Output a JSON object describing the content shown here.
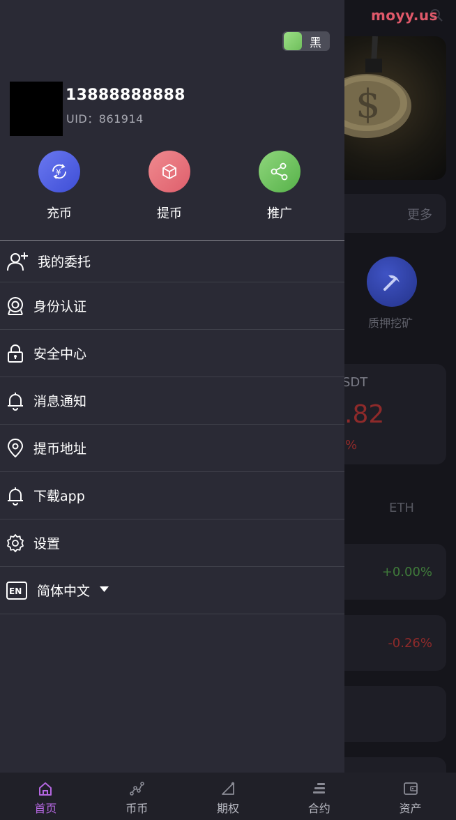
{
  "watermark": "moyy.us",
  "theme_toggle": {
    "label": "黑",
    "accent": "#7fcf6a"
  },
  "user": {
    "phone": "13888888888",
    "uid_label": "UID：",
    "uid": "861914"
  },
  "quick_actions": [
    {
      "label": "充币",
      "icon": "yen-cycle-icon",
      "color": "#4e5fe0"
    },
    {
      "label": "提币",
      "icon": "cube-icon",
      "color": "#e9727c"
    },
    {
      "label": "推广",
      "icon": "share-icon",
      "color": "#6ec25c"
    }
  ],
  "menu": [
    {
      "label": "我的委托",
      "icon": "user-add-icon"
    },
    {
      "label": "身份认证",
      "icon": "camera-icon"
    },
    {
      "label": "安全中心",
      "icon": "lock-icon"
    },
    {
      "label": "消息通知",
      "icon": "bell-icon"
    },
    {
      "label": "提币地址",
      "icon": "location-pin-icon"
    },
    {
      "label": "下载app",
      "icon": "bell-icon"
    },
    {
      "label": "设置",
      "icon": "gear-icon"
    },
    {
      "label": "简体中文",
      "icon": "en-icon"
    }
  ],
  "background": {
    "more": "更多",
    "mining_label": "质押挖矿",
    "usdt_fragment": "SDT",
    "price_fragment": ".82",
    "pct_fragment": "%",
    "eth_tab": "ETH",
    "change_1": "+0.00%",
    "change_2": "-0.26%"
  },
  "tabbar": [
    {
      "label": "首页",
      "icon": "home-icon",
      "active": true
    },
    {
      "label": "币币",
      "icon": "trend-icon",
      "active": false
    },
    {
      "label": "期权",
      "icon": "options-icon",
      "active": false
    },
    {
      "label": "合约",
      "icon": "contract-icon",
      "active": false
    },
    {
      "label": "资产",
      "icon": "wallet-icon",
      "active": false
    }
  ],
  "colors": {
    "drawer_bg": "#2a2a35",
    "tab_active": "#b467e0",
    "negative": "#c0392b",
    "positive": "#4caf50"
  }
}
